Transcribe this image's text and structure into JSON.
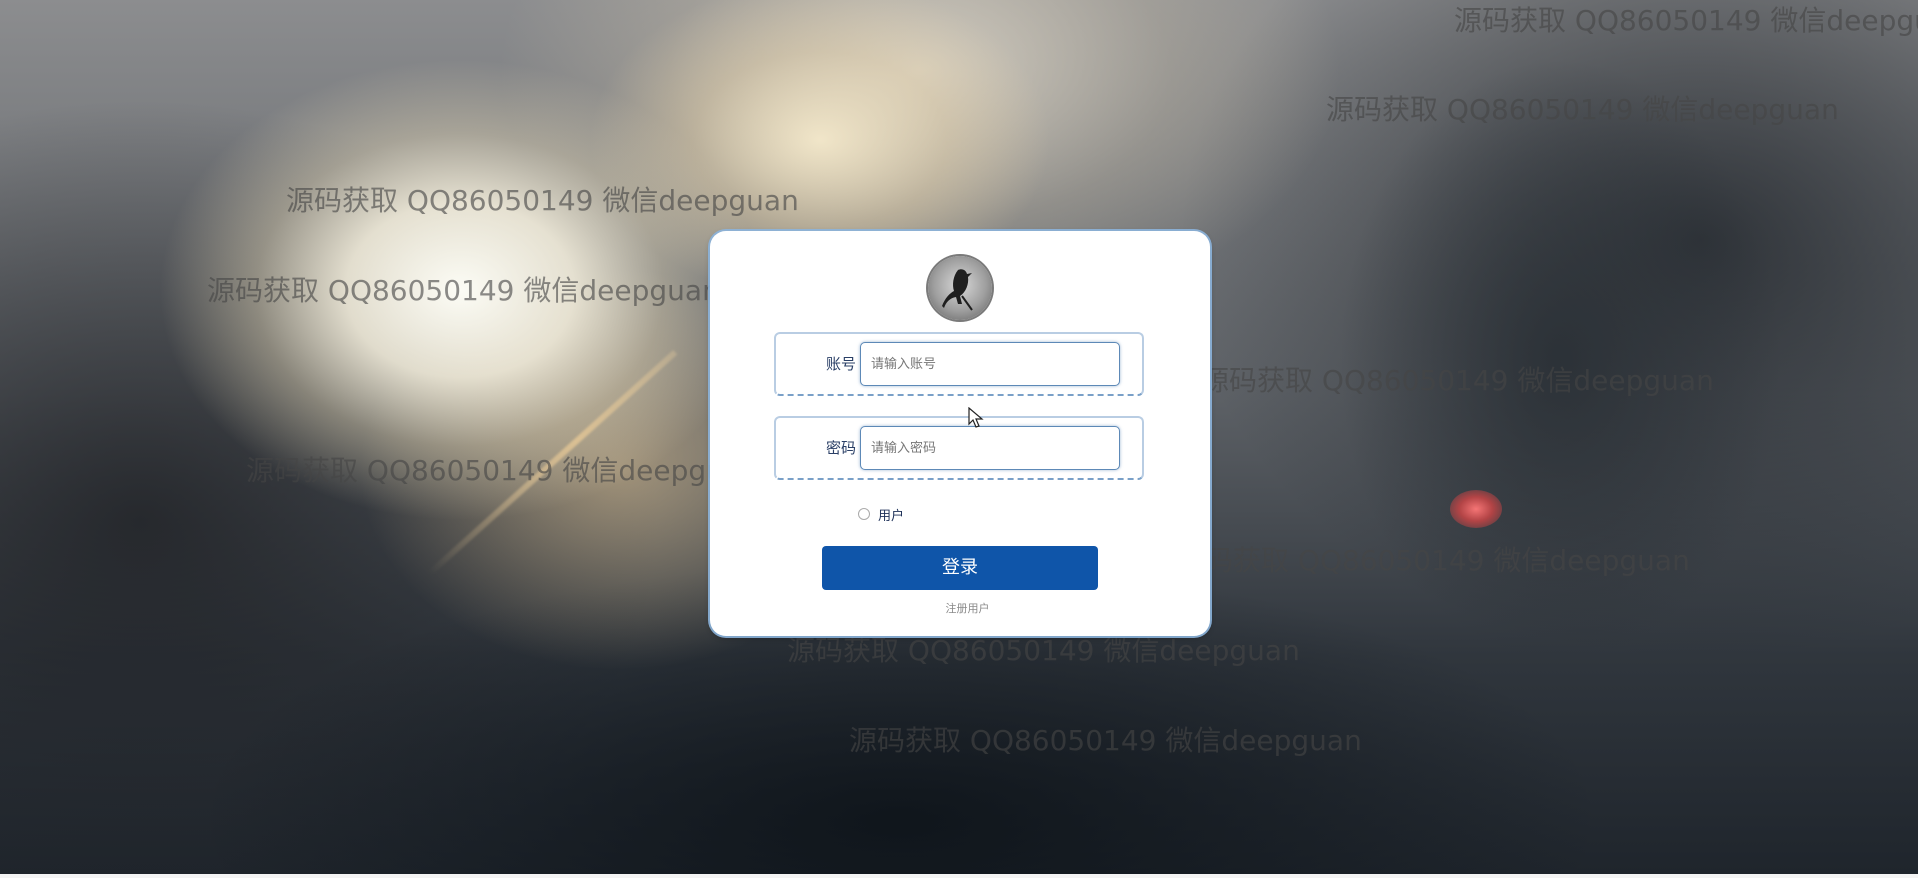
{
  "watermark_text": "源码获取 QQ86050149 微信deepguan",
  "login": {
    "username": {
      "label": "账号",
      "placeholder": "请输入账号",
      "value": ""
    },
    "password": {
      "label": "密码",
      "placeholder": "请输入密码",
      "value": ""
    },
    "role_option": "用户",
    "role_selected": false,
    "login_button": "登录",
    "register_link": "注册用户"
  },
  "colors": {
    "primary": "#0f55a9",
    "label_text": "#2a3f66",
    "field_border": "#b9cde3"
  },
  "icons": {
    "avatar": "bird-avatar-icon",
    "cursor": "mouse-pointer-icon"
  }
}
